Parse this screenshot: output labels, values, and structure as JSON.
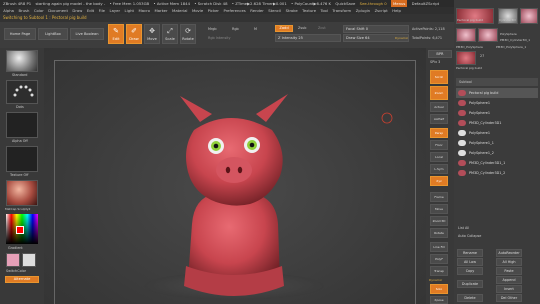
{
  "titlebar": {
    "items": [
      "ZBrush 4R8 P1",
      "starting again pig model - the body -",
      "• Free Mem 1.053GB",
      "• Active Mem 1844",
      "• Scratch Disk 48",
      "• ZTime▶2.628 Timer▶0.001",
      "• PolyCount▶6.476 K",
      "QuickSave"
    ],
    "see_through": "See-through 0",
    "menus_label": "Menus",
    "script_label": "DefaultZScript"
  },
  "menubar": [
    "Alpha",
    "Brush",
    "Color",
    "Document",
    "Draw",
    "Edit",
    "File",
    "Layer",
    "Light",
    "Macro",
    "Marker",
    "Material",
    "Movie",
    "Picker",
    "Preferences",
    "Render",
    "Stencil",
    "Stroke",
    "Texture",
    "Tool",
    "Transform",
    "Zplugin",
    "Zscript",
    "Help"
  ],
  "status": {
    "text": "Switching to Subtool 1 : Pectoral pig build"
  },
  "toolbar": {
    "home_page": "Home Page",
    "lightbox": "LightBox",
    "live_boolean": "Live Boolean",
    "edit": "Edit",
    "draw": "Draw",
    "move": "Move",
    "scale": "Scale",
    "rotate": "Rotate",
    "mrgb": "Mrgb",
    "rgb": "Rgb",
    "m": "M",
    "zadd": "Zadd",
    "zsub": "Zsub",
    "zcut": "Zcut",
    "rgb_intensity": "Rgb Intensity",
    "focal_shift": "Focal Shift 0",
    "z_intensity": "Z Intensity 25",
    "draw_size": "Draw Size 64",
    "active_points": "ActivePoints: 2,118",
    "total_points": "TotalPoints: 6,471",
    "dynamic": "Dynamic"
  },
  "leftshelf": {
    "standard": "Standard",
    "dots": "Dots",
    "alpha_off": "Alpha Off",
    "texture_off": "Texture Off",
    "matcap": "MatCap Sculpty2",
    "gradient": "Gradient",
    "switch_color": "SwitchColor",
    "alternate": "Alternate"
  },
  "rightshelf": {
    "bpr": "BPR",
    "spix": "SPix 3",
    "scroll": "Scroll",
    "zoom": "Zoom",
    "actual": "Actual",
    "aahalf": "AAHalf",
    "persp": "Persp",
    "floor": "Floor",
    "local": "Local",
    "lsym": "L.Sym",
    "xyz": "Xyz",
    "frame": "Frame",
    "move": "Move",
    "zoom3d": "Zoom3D",
    "rotate": "Rotate",
    "line_fill": "Line Fill",
    "polyf": "PolyF",
    "transp": "Transp",
    "dynamic": "Dynamic",
    "solo": "Solo",
    "xpose": "Xpose"
  },
  "rightpanel": {
    "tool_thumbs": [
      "Pectoral pig build",
      "Cylinder3D",
      "PolySphere",
      "PM3D_Cylinder3D_1",
      "PM3D_PolySphere",
      "PM3D_PolySphere_1"
    ],
    "current_tool": "Pectoral pig build",
    "count": "27",
    "subtool_header": "Subtool",
    "subtools": [
      "Pectoral pig build",
      "PolySphere1",
      "PolySphere1",
      "PM3D_Cylinder3D1",
      "PolySphere1",
      "PolySphere1_1",
      "PolySphere1_2",
      "PM3D_Cylinder3D1_1",
      "PM3D_Cylinder3D1_2"
    ],
    "list_all": "List All",
    "auto_collapse": "Auto Collapse",
    "rename": "Rename",
    "auto_reorder": "AutoReorder",
    "all_low": "All Low",
    "all_high": "All High",
    "copy": "Copy",
    "paste": "Paste",
    "append": "Append",
    "duplicate": "Duplicate",
    "insert": "Insert",
    "del_other": "Del Other",
    "delete": "Delete"
  },
  "colors": {
    "accent": "#e07b24",
    "pig": "#c8454e",
    "eye": "#8fcf3a"
  }
}
